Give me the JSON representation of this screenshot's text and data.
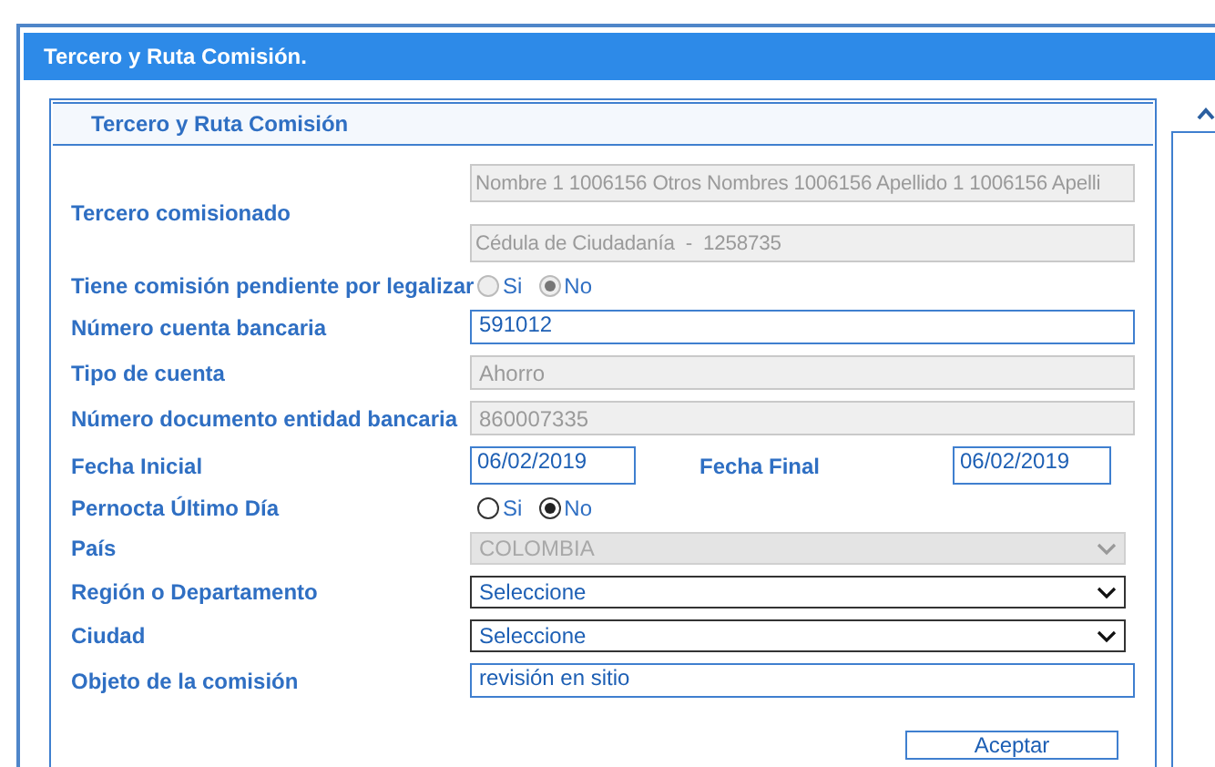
{
  "window": {
    "title": "Tercero y Ruta Comisión."
  },
  "panel": {
    "title": "Tercero y Ruta Comisión"
  },
  "rows": [
    {
      "kind": "stacked",
      "label": "Tercero comisionado",
      "fields": [
        {
          "value": "Nombre 1 1006156 Otros Nombres 1006156 Apellido 1 1006156 Apelli",
          "disabled": true
        },
        {
          "value": "Cédula de Ciudadanía  -  1258735",
          "disabled": true
        }
      ]
    },
    {
      "kind": "radio",
      "label": "Tiene comisión pendiente por legalizar",
      "disabled": true,
      "options": [
        {
          "label": "Si",
          "selected": false
        },
        {
          "label": "No",
          "selected": true
        }
      ]
    },
    {
      "kind": "text",
      "label": "Número cuenta bancaria",
      "value": "591012",
      "disabled": false
    },
    {
      "kind": "text",
      "label": "Tipo de cuenta",
      "value": "Ahorro",
      "disabled": true
    },
    {
      "kind": "text",
      "label": "Número documento entidad bancaria",
      "value": "860007335",
      "disabled": true
    },
    {
      "kind": "dates",
      "fields": [
        {
          "label": "Fecha Inicial",
          "value": "06/02/2019"
        },
        {
          "label": "Fecha Final",
          "value": "06/02/2019"
        }
      ]
    },
    {
      "kind": "radio",
      "label": "Pernocta Último Día",
      "disabled": false,
      "options": [
        {
          "label": "Si",
          "selected": false
        },
        {
          "label": "No",
          "selected": true
        }
      ]
    },
    {
      "kind": "select",
      "label": "País",
      "value": "COLOMBIA",
      "disabled": true
    },
    {
      "kind": "select",
      "label": "Región o Departamento",
      "value": "Seleccione",
      "disabled": false
    },
    {
      "kind": "select",
      "label": "Ciudad",
      "value": "Seleccione",
      "disabled": false
    },
    {
      "kind": "text",
      "label": "Objeto de la comisión",
      "value": "revisión en sitio",
      "disabled": false
    }
  ],
  "buttons": [
    "Aceptar"
  ]
}
